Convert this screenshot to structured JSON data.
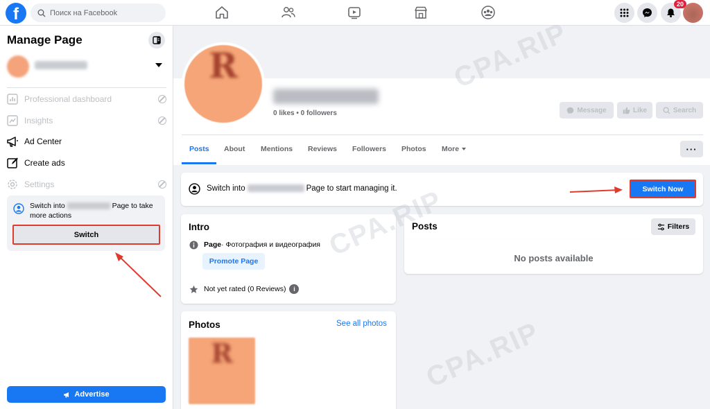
{
  "topbar": {
    "logo": "f",
    "search_placeholder": "Поиск на Facebook",
    "nav_icons": [
      "home-icon",
      "friends-icon",
      "watch-icon",
      "marketplace-icon",
      "groups-icon"
    ],
    "right_icons": [
      "menu-grid-icon",
      "messenger-icon",
      "notifications-icon"
    ],
    "notification_count": "20"
  },
  "sidebar": {
    "title": "Manage Page",
    "items": [
      {
        "label": "Professional dashboard",
        "icon": "dashboard-icon",
        "disabled": true
      },
      {
        "label": "Insights",
        "icon": "insights-icon",
        "disabled": true
      },
      {
        "label": "Ad Center",
        "icon": "megaphone-icon",
        "disabled": false
      },
      {
        "label": "Create ads",
        "icon": "pencil-icon",
        "disabled": false
      },
      {
        "label": "Settings",
        "icon": "gear-icon",
        "disabled": true
      }
    ],
    "switch_prompt_prefix": "Switch into",
    "switch_prompt_suffix": "Page to take more actions",
    "switch_button": "Switch",
    "advertise_button": "Advertise"
  },
  "page_header": {
    "avatar_letter": "R",
    "stats": "0 likes • 0 followers",
    "buttons": [
      "Message",
      "Like",
      "Search"
    ]
  },
  "tabs": [
    "Posts",
    "About",
    "Mentions",
    "Reviews",
    "Followers",
    "Photos",
    "More"
  ],
  "switch_banner": {
    "prefix": "Switch into",
    "suffix": "Page to start managing it.",
    "button": "Switch Now"
  },
  "intro": {
    "title": "Intro",
    "category_bold": "Page",
    "category_text": " · Фотография и видеография",
    "promote_button": "Promote Page",
    "rating": "Not yet rated (0 Reviews)"
  },
  "photos": {
    "title": "Photos",
    "see_all": "See all photos"
  },
  "posts": {
    "title": "Posts",
    "filters_button": "Filters",
    "empty_text": "No posts available"
  },
  "watermark": "CPA.RIP",
  "colors": {
    "brand_blue": "#1877f2",
    "highlight_red": "#e03a2d",
    "background": "#f0f2f5"
  }
}
